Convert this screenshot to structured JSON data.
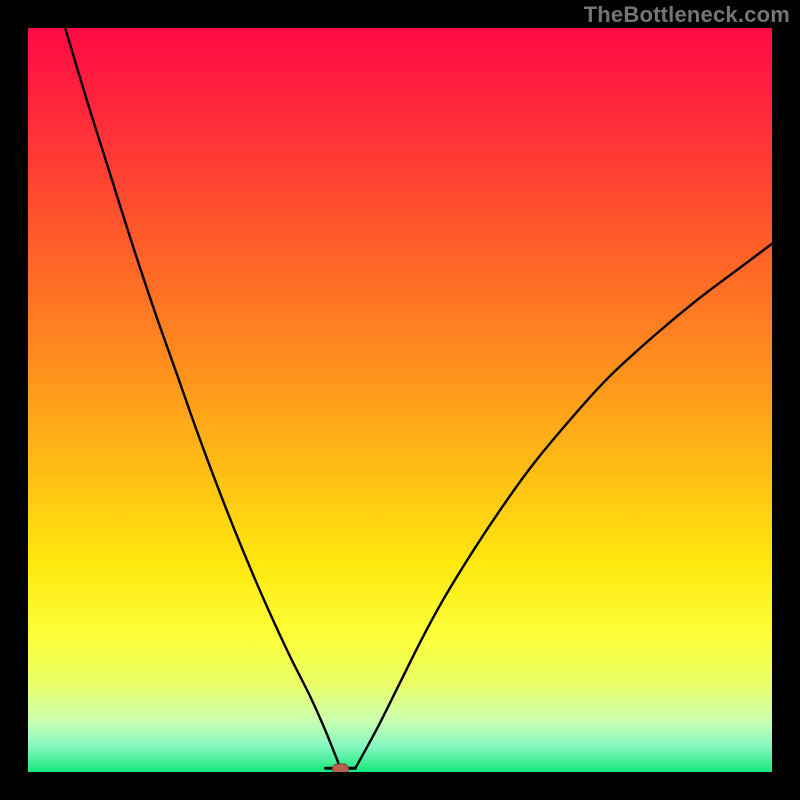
{
  "watermark": "TheBottleneck.com",
  "colors": {
    "frame": "#000000",
    "curve": "#000000",
    "marker_fill": "#b7604f",
    "marker_stroke": "#8a3f32",
    "gradient_stops": [
      {
        "offset": 0.0,
        "color": "#ff0a45"
      },
      {
        "offset": 0.12,
        "color": "#ff2a3a"
      },
      {
        "offset": 0.28,
        "color": "#ff5a2a"
      },
      {
        "offset": 0.45,
        "color": "#ff8e1e"
      },
      {
        "offset": 0.6,
        "color": "#ffbf14"
      },
      {
        "offset": 0.72,
        "color": "#ffe80e"
      },
      {
        "offset": 0.82,
        "color": "#fcff3a"
      },
      {
        "offset": 0.88,
        "color": "#eaff66"
      },
      {
        "offset": 0.93,
        "color": "#ccffb0"
      },
      {
        "offset": 0.965,
        "color": "#86f7c0"
      },
      {
        "offset": 1.0,
        "color": "#16e87c"
      }
    ]
  },
  "chart_data": {
    "type": "line",
    "title": "",
    "xlabel": "",
    "ylabel": "",
    "xlim": [
      0,
      100
    ],
    "ylim": [
      0,
      100
    ],
    "grid": false,
    "legend": false,
    "annotations": [],
    "marker": {
      "x": 42,
      "y": 0
    },
    "curve_left": {
      "x": [
        5,
        8,
        11,
        14,
        17,
        20,
        23,
        26,
        29,
        32,
        35,
        38,
        40,
        42
      ],
      "y": [
        100,
        90,
        80.5,
        71,
        62,
        53.5,
        45,
        37,
        29.5,
        22.5,
        16,
        10,
        5.5,
        0.5
      ]
    },
    "flat_segment": {
      "x": [
        40,
        44
      ],
      "y": [
        0.5,
        0.5
      ]
    },
    "curve_right": {
      "x": [
        44,
        47,
        50,
        53,
        56,
        60,
        64,
        68,
        73,
        78,
        84,
        90,
        96,
        100
      ],
      "y": [
        0.5,
        6,
        12,
        18,
        23.5,
        30,
        36,
        41.5,
        47.5,
        53,
        58.5,
        63.5,
        68,
        71
      ]
    }
  }
}
